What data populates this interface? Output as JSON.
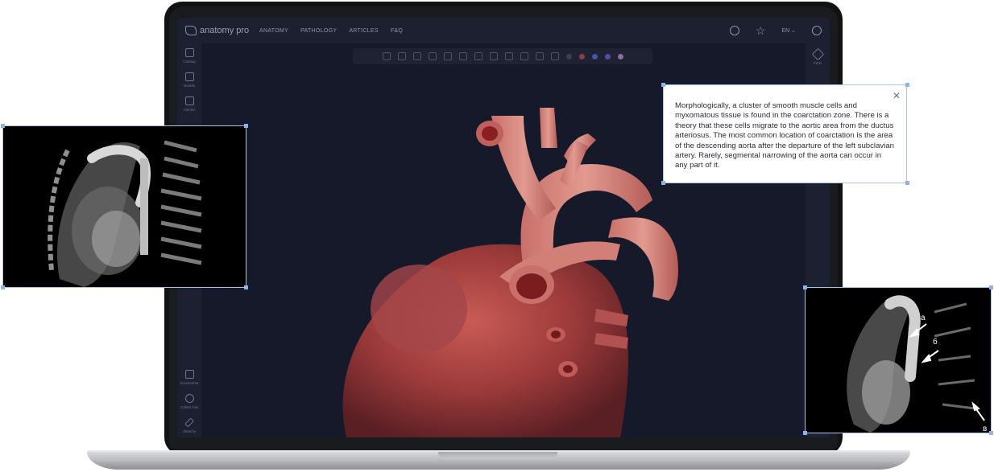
{
  "app": {
    "logo": "anatomy pro",
    "nav": [
      "ANATOMY",
      "PATHOLOGY",
      "ARTICLES",
      "F&Q"
    ],
    "language": "EN",
    "icons": [
      "search-icon",
      "star-icon",
      "user-icon"
    ]
  },
  "sidebar": {
    "items": [
      {
        "label": "Catalog",
        "icon": "catalog-icon"
      },
      {
        "label": "Models",
        "icon": "models-icon"
      },
      {
        "label": "Articles",
        "icon": "articles-icon"
      },
      {
        "label": "Screenshot",
        "icon": "screenshot-icon"
      },
      {
        "label": "Collect Fav",
        "icon": "star-icon"
      },
      {
        "label": "Sketchy",
        "icon": "pencil-icon"
      }
    ]
  },
  "rightbar": {
    "items": [
      {
        "label": "Parts",
        "icon": "layers-icon"
      }
    ]
  },
  "toolbar": {
    "colors": [
      "#3a3f52",
      "#8a3d4a",
      "#3d5aa8",
      "#5a4aa8",
      "#8a6aa8"
    ]
  },
  "popup": {
    "text": "Morphologically, a cluster of smooth muscle cells and myxomatous tissue is found in the coarctation zone. There is a theory that these cells migrate to the aortic area from the ductus arteriosus. The most common location of coarctation is the area of the descending aorta after the departure of the left subclavian artery. Rarely, segmental narrowing of the aorta can occur in any part of it."
  },
  "scan_labels": {
    "a": "а",
    "b": "б",
    "v": "в"
  }
}
